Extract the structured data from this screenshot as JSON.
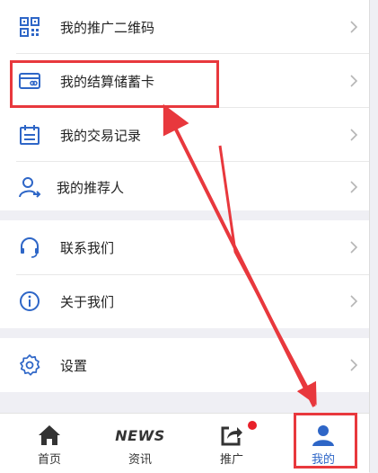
{
  "menu": {
    "group1": [
      {
        "label": "我的推广二维码",
        "icon": "qr-code-icon"
      },
      {
        "label": "我的结算储蓄卡",
        "icon": "bank-card-icon"
      },
      {
        "label": "我的交易记录",
        "icon": "calendar-icon"
      },
      {
        "label": "我的推荐人",
        "icon": "person-arrow-icon"
      }
    ],
    "group2": [
      {
        "label": "联系我们",
        "icon": "headset-icon"
      },
      {
        "label": "关于我们",
        "icon": "info-icon"
      }
    ],
    "group3": [
      {
        "label": "设置",
        "icon": "gear-icon"
      }
    ]
  },
  "tabbar": {
    "home": "首页",
    "news_word": "NEWS",
    "news": "资讯",
    "promote": "推广",
    "mine": "我的"
  },
  "colors": {
    "accent": "#2e66c7",
    "highlight": "#e8383d",
    "badge": "#e8202a"
  }
}
